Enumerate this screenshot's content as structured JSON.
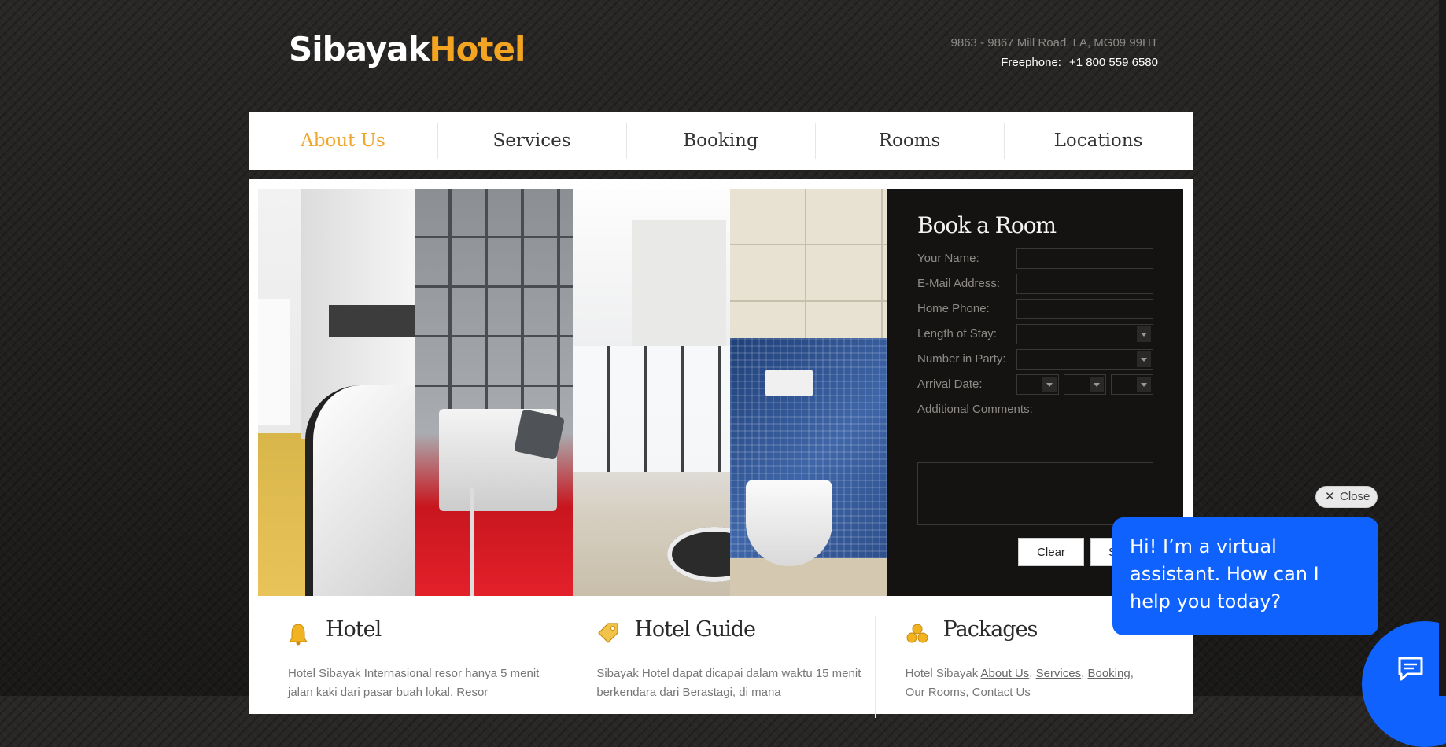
{
  "header": {
    "logo_part1": "Sibayak",
    "logo_part2": "Hotel",
    "address": "9863 - 9867 Mill Road, LA, MG09 99HT",
    "phone_label": "Freephone:",
    "phone_number": "+1 800 559 6580"
  },
  "nav": {
    "items": [
      {
        "label": "About Us",
        "active": true
      },
      {
        "label": "Services",
        "active": false
      },
      {
        "label": "Booking",
        "active": false
      },
      {
        "label": "Rooms",
        "active": false
      },
      {
        "label": "Locations",
        "active": false
      }
    ]
  },
  "booking": {
    "title": "Book a Room",
    "name_label": "Your Name:",
    "email_label": "E-Mail Address:",
    "phone_label": "Home Phone:",
    "stay_label": "Length of Stay:",
    "party_label": "Number in Party:",
    "arrival_label": "Arrival Date:",
    "comments_label": "Additional Comments:",
    "clear_button": "Clear",
    "submit_button": "S"
  },
  "features": [
    {
      "title": "Hotel",
      "text": "Hotel Sibayak Internasional resor hanya 5 menit jalan kaki dari pasar buah lokal. Resor",
      "icon": "bell-icon"
    },
    {
      "title": "Hotel Guide",
      "text": "Sibayak Hotel dapat dicapai dalam waktu 15 menit berkendara dari Berastagi, di mana",
      "icon": "tag-icon"
    },
    {
      "title": "Packages",
      "text_prefix": "Hotel Sibayak ",
      "links": [
        "About Us",
        "Services",
        "Booking",
        "Our Rooms",
        "Contact Us"
      ],
      "icon": "coins-icon"
    }
  ],
  "chat": {
    "close_label": "Close",
    "message": "Hi! I’m a virtual assistant. How can I help you today?"
  },
  "colors": {
    "accent": "#f3a421",
    "chat_blue": "#0f62fe"
  }
}
